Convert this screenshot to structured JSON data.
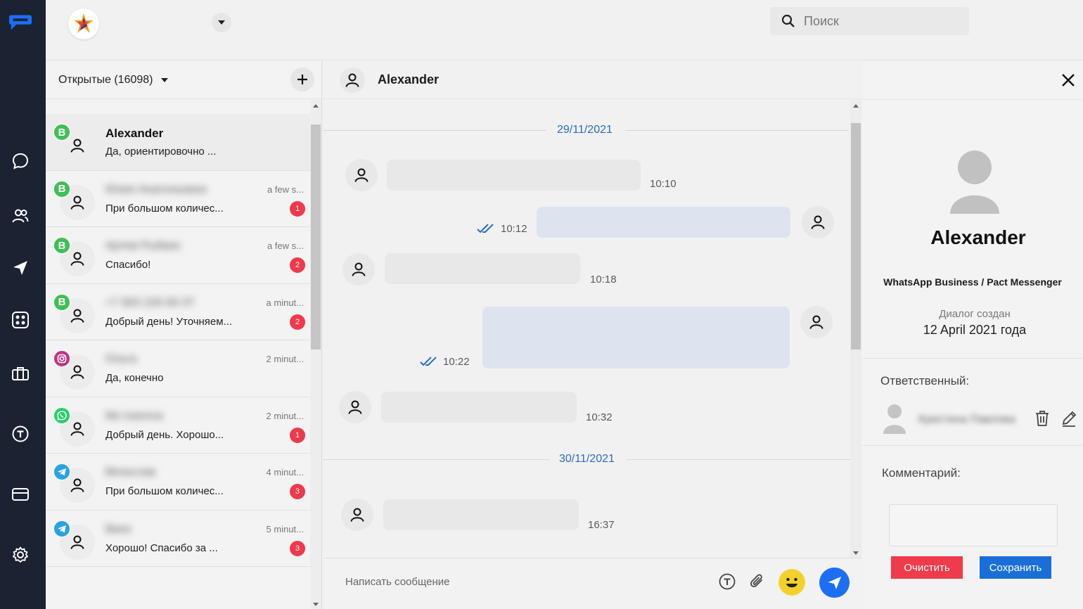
{
  "colors": {
    "rail_bg": "#1b2232",
    "brand_blue": "#1c6ff5",
    "accent_link": "#2d6cc0",
    "unread_badge": "#f0394a",
    "whatsapp_business": "#3fbf55",
    "whatsapp": "#25d366",
    "telegram": "#2aa3e0",
    "instagram": "#c13584",
    "outgoing_bubble": "#dde3ef",
    "incoming_bubble": "#e8e8e8"
  },
  "rail": {
    "items": [
      {
        "icon": "chat-bubble-icon"
      },
      {
        "icon": "contacts-icon"
      },
      {
        "icon": "paper-plane-icon"
      },
      {
        "icon": "apps-grid-icon"
      },
      {
        "icon": "briefcase-icon"
      },
      {
        "icon": "template-icon"
      },
      {
        "icon": "billing-card-icon"
      },
      {
        "icon": "settings-gear-icon"
      }
    ]
  },
  "topbar": {
    "search_placeholder": "Поиск"
  },
  "conversation_list": {
    "filter_label": "Открытые (16098)",
    "items": [
      {
        "channel": "whatsapp-business",
        "channel_glyph": "B",
        "name": "Alexander",
        "name_blurred": false,
        "preview": "Да, ориентировочно ...",
        "time": "",
        "unread": ""
      },
      {
        "channel": "whatsapp-business",
        "channel_glyph": "B",
        "name": "Юлия Анатольевна",
        "name_blurred": true,
        "preview": "При большом количес...",
        "time": "a few s...",
        "unread": "1"
      },
      {
        "channel": "whatsapp-business",
        "channel_glyph": "B",
        "name": "Артем Рыбкин",
        "name_blurred": true,
        "preview": "Спасибо!",
        "time": "a few s...",
        "unread": "2"
      },
      {
        "channel": "whatsapp-business",
        "channel_glyph": "B",
        "name": "+7 903 226-00-37",
        "name_blurred": true,
        "preview": "Добрый день! Уточняем...",
        "time": "a minut...",
        "unread": "2"
      },
      {
        "channel": "instagram",
        "channel_glyph": "",
        "name": "Ольга",
        "name_blurred": true,
        "preview": "Да, конечно",
        "time": "2 minut...",
        "unread": ""
      },
      {
        "channel": "whatsapp",
        "channel_glyph": "",
        "name": "Ms Ivanova",
        "name_blurred": true,
        "preview": "Добрый день. Хорошо...",
        "time": "2 minut...",
        "unread": "1"
      },
      {
        "channel": "telegram",
        "channel_glyph": "",
        "name": "Вячеслав",
        "name_blurred": true,
        "preview": "При большом количес...",
        "time": "4 minut...",
        "unread": "3"
      },
      {
        "channel": "telegram",
        "channel_glyph": "",
        "name": "Вика",
        "name_blurred": true,
        "preview": "Хорошо! Спасибо за ...",
        "time": "5 minut...",
        "unread": "3"
      }
    ]
  },
  "chat": {
    "header_name": "Alexander",
    "date_separators": [
      "29/11/2021",
      "30/11/2021"
    ],
    "messages": [
      {
        "direction": "in",
        "time": "10:10"
      },
      {
        "direction": "out",
        "time": "10:12"
      },
      {
        "direction": "in",
        "time": "10:18"
      },
      {
        "direction": "out",
        "time": "10:22"
      },
      {
        "direction": "in",
        "time": "10:32"
      },
      {
        "direction": "in",
        "time": "16:37"
      }
    ],
    "composer_placeholder": "Написать сообщение"
  },
  "profile": {
    "name": "Alexander",
    "channel": "WhatsApp Business / Pact Messenger",
    "created_label": "Диалог создан",
    "created_value": "12 April 2021 года",
    "responsible_label": "Ответственный:",
    "responsible_name": "Кристина Павлова",
    "comment_label": "Комментарий:",
    "clear_label": "Очистить",
    "save_label": "Сохранить"
  }
}
